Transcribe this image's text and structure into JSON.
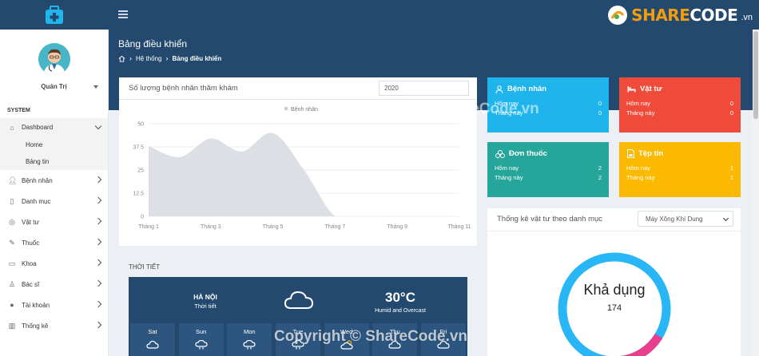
{
  "brand": {
    "part1": "SHARE",
    "part2": "CODE",
    "tld": ".vn"
  },
  "sidebar": {
    "user_name": "Quản Trị",
    "section": "SYSTEM",
    "dashboard": "Dashboard",
    "sub": [
      "Home",
      "Bảng tin"
    ],
    "items": [
      "Bệnh nhân",
      "Danh mục",
      "Vật tư",
      "Thuốc",
      "Khoa",
      "Bác sĩ",
      "Tài khoản",
      "Thống kê"
    ]
  },
  "header": {
    "title": "Bảng điều khiển",
    "crumb1": "Hệ thống",
    "crumb2": "Bảng điều khiển"
  },
  "chart": {
    "title": "Số lượng bệnh nhân thăm khám",
    "year": "2020"
  },
  "chart_data": {
    "type": "area",
    "series": [
      {
        "name": "Bệnh nhân",
        "values": [
          38,
          32,
          42,
          35,
          45,
          25,
          0,
          0,
          0,
          0,
          0
        ]
      }
    ],
    "categories": [
      "Tháng 1",
      "Tháng 2",
      "Tháng 3",
      "Tháng 4",
      "Tháng 5",
      "Tháng 6",
      "Tháng 7",
      "Tháng 8",
      "Tháng 9",
      "Tháng 10",
      "Tháng 11"
    ],
    "x_tick_labels": [
      "Tháng 1",
      "Tháng 3",
      "Tháng 5",
      "Tháng 7",
      "Tháng 9",
      "Tháng 11"
    ],
    "y_ticks": [
      "0",
      "12.5",
      "25",
      "37.5",
      "50"
    ],
    "ylim": [
      0,
      50
    ],
    "legend": "top-center",
    "color": "#dcdfe3"
  },
  "weather": {
    "section_title": "THỜI TIẾT",
    "city": "HÀ NỘI",
    "subtitle": "Thời tiết",
    "temp": "30°C",
    "desc": "Humid and Overcast",
    "days": [
      "Sat",
      "Sun",
      "Mon",
      "Tue",
      "Wed",
      "Thu",
      "Fri"
    ]
  },
  "stats": [
    {
      "title": "Bệnh nhân",
      "rows": [
        {
          "k": "Hôm nay",
          "v": "0"
        },
        {
          "k": "Tháng này",
          "v": "0"
        }
      ],
      "color": "#1fb5ec"
    },
    {
      "title": "Vật tư",
      "rows": [
        {
          "k": "Hôm nay",
          "v": "0"
        },
        {
          "k": "Tháng này",
          "v": "0"
        }
      ],
      "color": "#f04a3b"
    },
    {
      "title": "Đơn thuốc",
      "rows": [
        {
          "k": "Hôm nay",
          "v": "2"
        },
        {
          "k": "Tháng này",
          "v": "2"
        }
      ],
      "color": "#26a69a"
    },
    {
      "title": "Tệp tin",
      "rows": [
        {
          "k": "Hôm nay",
          "v": "1"
        },
        {
          "k": "Tháng này",
          "v": "1"
        }
      ],
      "color": "#fbb900"
    }
  ],
  "donut": {
    "title": "Thống kê vật tư theo danh mục",
    "select": "Máy Xông Khí Dung",
    "label": "Khả dụng",
    "value": "174"
  },
  "watermarks": {
    "top": "ShareCode.vn",
    "bottom": "Copyright © ShareCode.vn"
  }
}
